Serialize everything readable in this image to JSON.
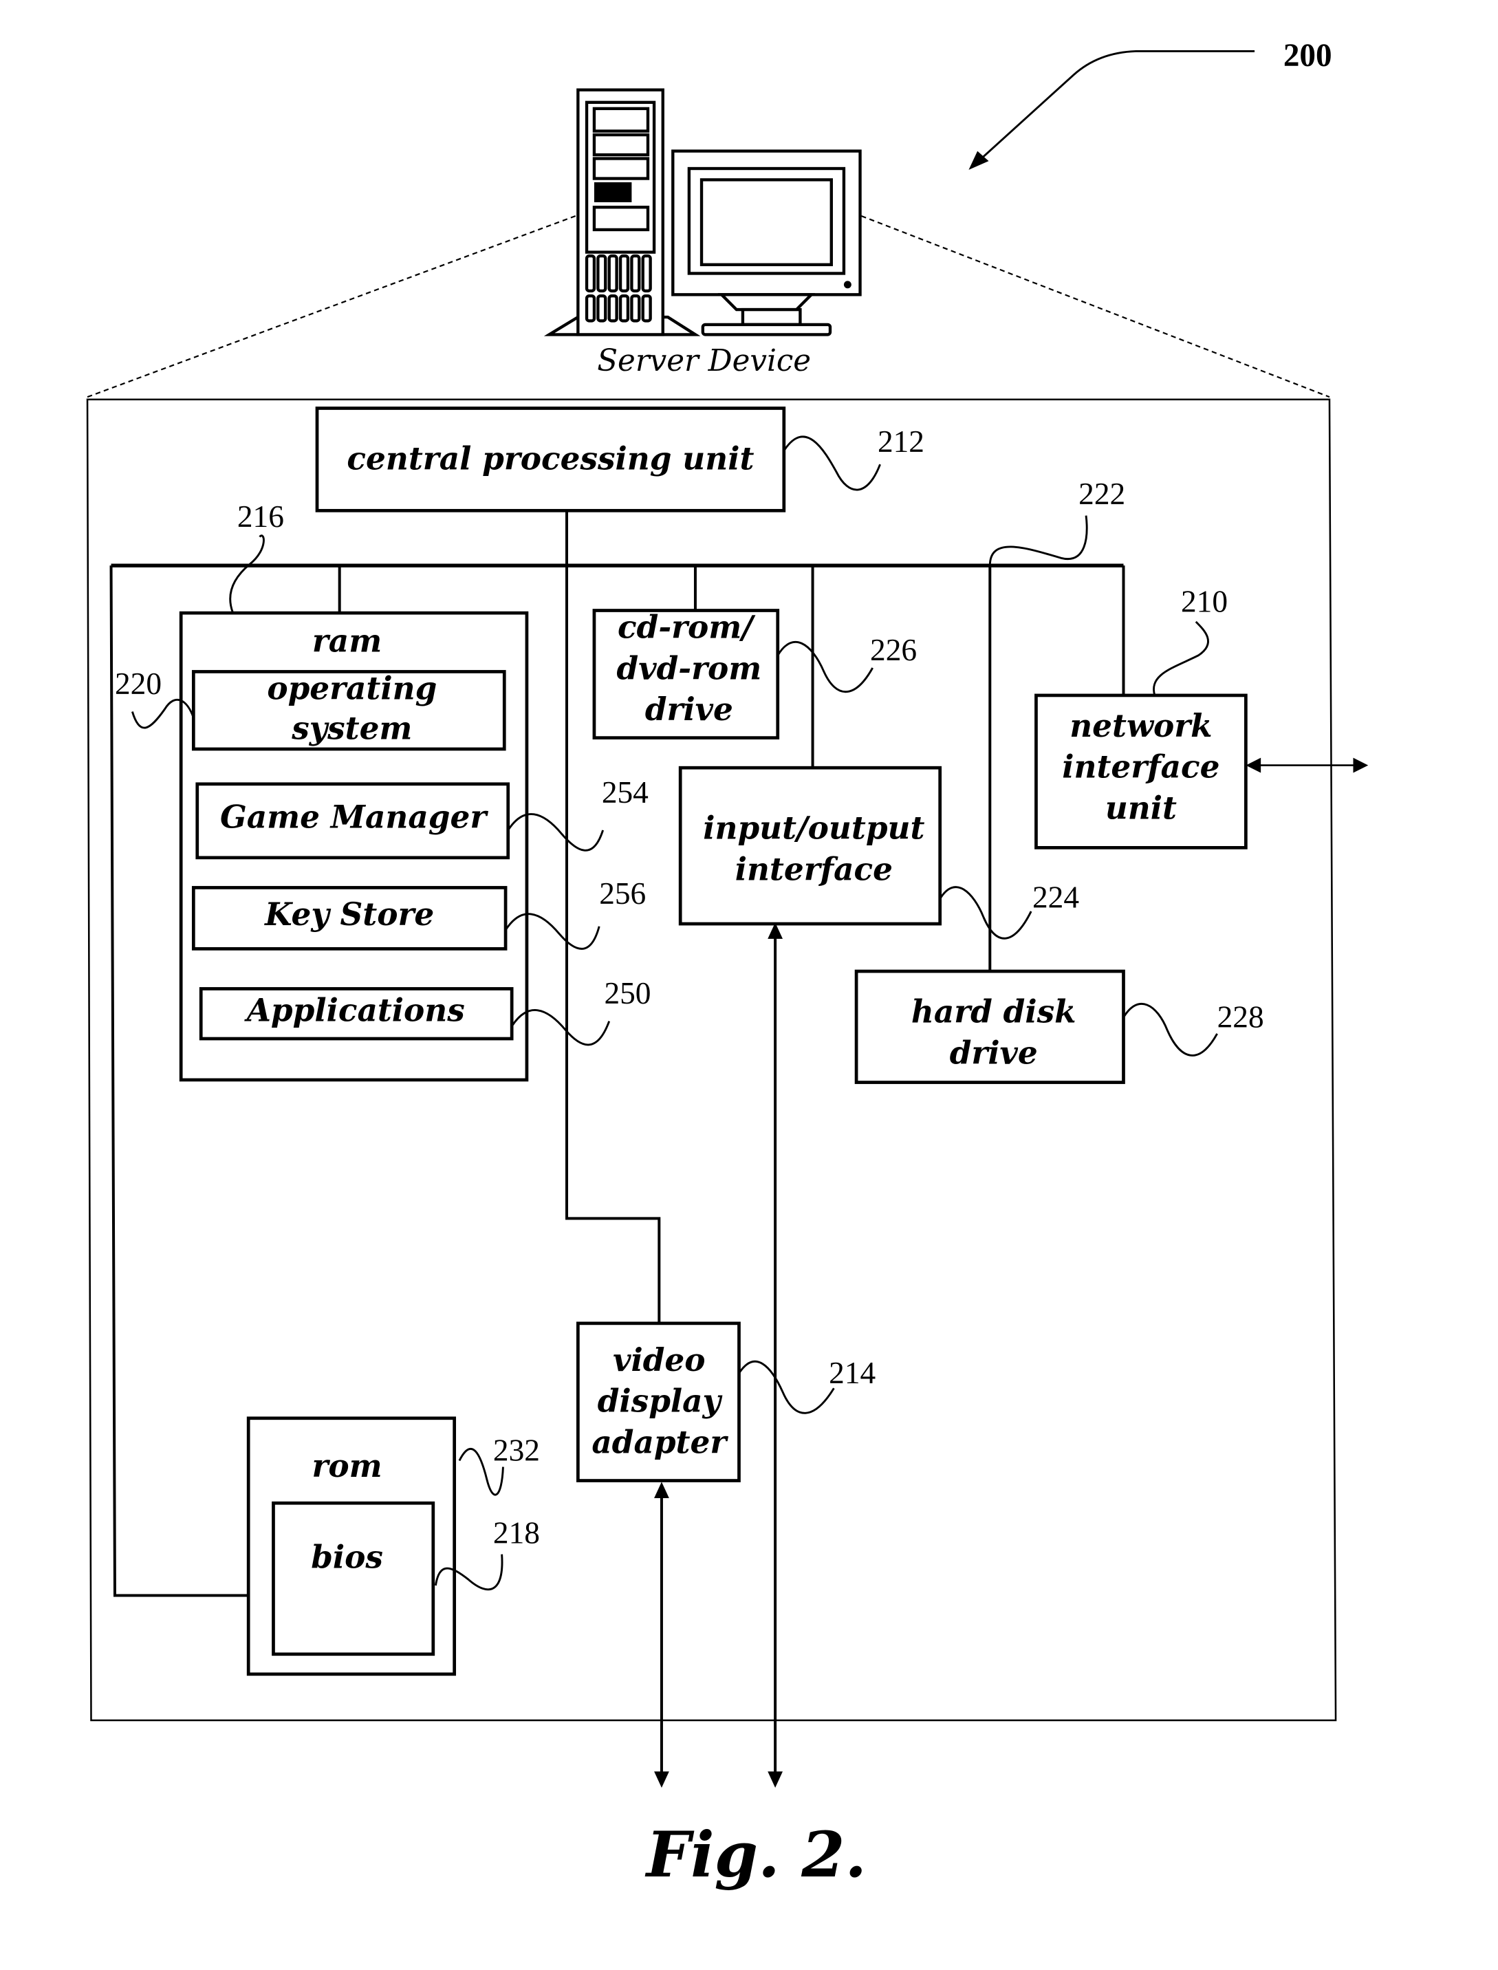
{
  "figure": {
    "caption": "Fig. 2.",
    "reference": "200",
    "device_label": "Server Device"
  },
  "components": {
    "cpu": {
      "label": "central processing unit",
      "ref": "212"
    },
    "bus": {
      "ref": "222"
    },
    "ram": {
      "label": "ram",
      "ref": "216"
    },
    "os": {
      "line1": "operating",
      "line2": "system",
      "ref": "220"
    },
    "game_manager": {
      "label": "Game Manager",
      "ref": "254"
    },
    "key_store": {
      "label": "Key Store",
      "ref": "256"
    },
    "applications": {
      "label": "Applications",
      "ref": "250"
    },
    "cdrom": {
      "line1": "cd-rom/",
      "line2": "dvd-rom",
      "line3": "drive",
      "ref": "226"
    },
    "io": {
      "line1": "input/output",
      "line2": "interface",
      "ref": "224"
    },
    "network": {
      "line1": "network",
      "line2": "interface",
      "line3": "unit",
      "ref": "210"
    },
    "hdd": {
      "line1": "hard disk",
      "line2": "drive",
      "ref": "228"
    },
    "video": {
      "line1": "video",
      "line2": "display",
      "line3": "adapter",
      "ref": "214"
    },
    "rom": {
      "label": "rom",
      "ref": "232"
    },
    "bios": {
      "label": "bios",
      "ref": "218"
    }
  }
}
